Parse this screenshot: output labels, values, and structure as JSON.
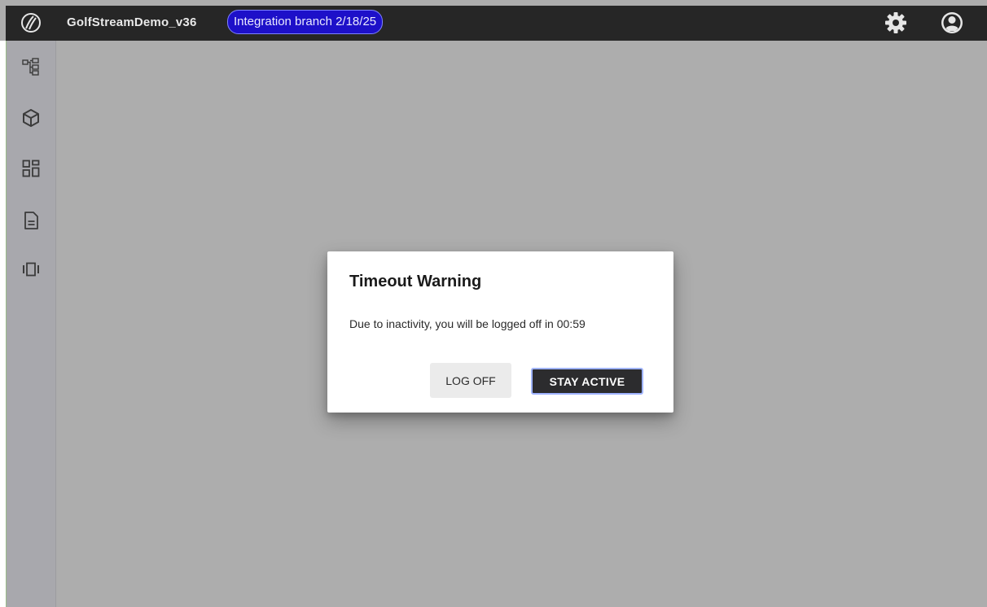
{
  "header": {
    "app_title": "GolfStreamDemo_v36",
    "branch_badge": "Integration branch 2/18/25"
  },
  "icons": {
    "logo": "circle-slash-logo-icon",
    "settings": "gear-icon",
    "user": "account-circle-icon"
  },
  "sidebar": {
    "items": [
      {
        "icon": "hierarchy-icon"
      },
      {
        "icon": "cube-icon"
      },
      {
        "icon": "dashboard-icon"
      },
      {
        "icon": "document-icon"
      },
      {
        "icon": "carousel-icon"
      }
    ]
  },
  "dialog": {
    "title": "Timeout Warning",
    "message": "Due to inactivity, you will be logged off in 00:59",
    "logoff_label": "LOG OFF",
    "stay_label": "STAY ACTIVE"
  },
  "colors": {
    "topbar": "#262626",
    "badge_bg": "#1d10c9",
    "badge_border": "#7f84ff",
    "overlay": "#adadad",
    "primary_button": "#2c2c2e"
  }
}
